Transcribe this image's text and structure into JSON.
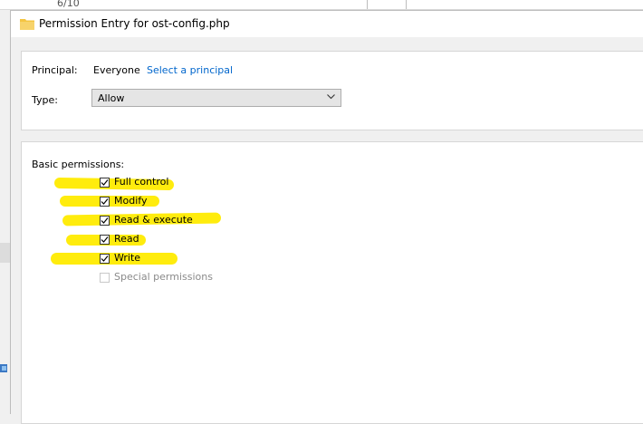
{
  "background": {
    "top_text": "6/10"
  },
  "dialog": {
    "title": "Permission Entry for ost-config.php",
    "principal_label": "Principal:",
    "principal_value": "Everyone",
    "select_principal_link": "Select a principal",
    "type_label": "Type:",
    "type_value": "Allow",
    "basic_permissions_label": "Basic permissions:",
    "permissions": [
      {
        "label": "Full control",
        "checked": true,
        "enabled": true
      },
      {
        "label": "Modify",
        "checked": true,
        "enabled": true
      },
      {
        "label": "Read & execute",
        "checked": true,
        "enabled": true
      },
      {
        "label": "Read",
        "checked": true,
        "enabled": true
      },
      {
        "label": "Write",
        "checked": true,
        "enabled": true
      },
      {
        "label": "Special permissions",
        "checked": false,
        "enabled": false
      }
    ]
  },
  "colors": {
    "highlight": "#ffeb00",
    "link": "#0066cc",
    "folder": "#f4c542"
  },
  "icons": {
    "title": "folder-icon",
    "dropdown": "chevron-down-icon"
  }
}
